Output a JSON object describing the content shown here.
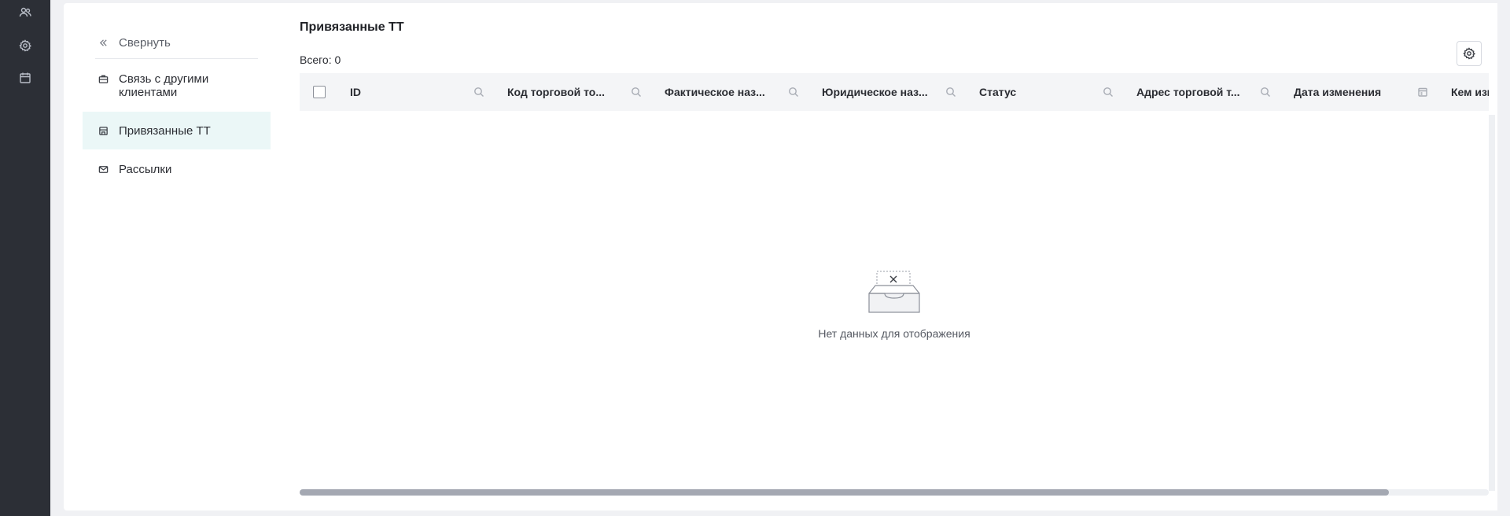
{
  "rail": {
    "icons": [
      "users-icon",
      "gear-icon",
      "calendar-icon"
    ]
  },
  "subnav": {
    "collapse_label": "Свернуть",
    "items": [
      {
        "label": "Связь с другими клиентами",
        "icon": "briefcase-icon"
      },
      {
        "label": "Привязанные ТТ",
        "icon": "store-icon",
        "active": true
      },
      {
        "label": "Рассылки",
        "icon": "mail-icon"
      }
    ]
  },
  "main": {
    "title": "Привязанные ТТ",
    "total": "Всего: 0",
    "columns": [
      {
        "label": "ID",
        "filter": "search-icon"
      },
      {
        "label": "Код торговой то...",
        "filter": "search-icon"
      },
      {
        "label": "Фактическое наз...",
        "filter": "search-icon"
      },
      {
        "label": "Юридическое наз...",
        "filter": "search-icon"
      },
      {
        "label": "Статус",
        "filter": "search-icon"
      },
      {
        "label": "Адрес торговой т...",
        "filter": "search-icon"
      },
      {
        "label": "Дата изменения",
        "filter": "calendar-icon"
      },
      {
        "label": "Кем изм",
        "filter": ""
      }
    ],
    "empty_text": "Нет данных для отображения"
  },
  "colors": {
    "rail_bg": "#2c2f36",
    "active_item_bg": "#ebf7f7",
    "header_bg": "#f4f5f7"
  }
}
